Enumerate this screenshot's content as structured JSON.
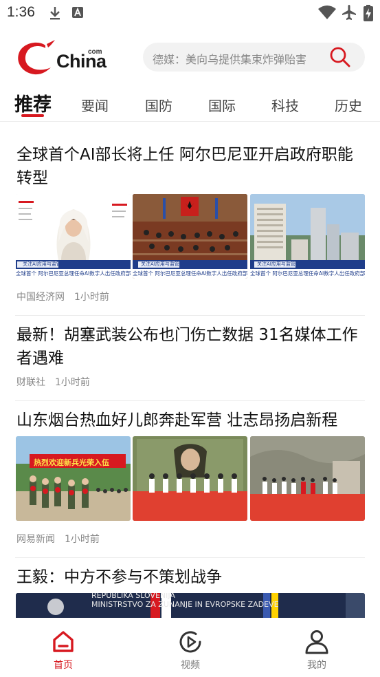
{
  "status_bar": {
    "time": "1:36"
  },
  "header": {
    "logo_text": "China",
    "logo_sup": "com",
    "search_placeholder": "德媒：美向乌提供集束炸弹贻害"
  },
  "tabs": [
    {
      "label": "推荐"
    },
    {
      "label": "要闻"
    },
    {
      "label": "国防"
    },
    {
      "label": "国际"
    },
    {
      "label": "科技"
    },
    {
      "label": "历史"
    }
  ],
  "articles": [
    {
      "title": "全球首个AI部长将上任 阿尔巴尼亚开启政府职能转型",
      "source": "中国经济网",
      "time": "1小时前",
      "caption_tag": "关注AI应用与监管",
      "caption_text": "全球首个 阿尔巴尼亚总理任命AI数字人出任政府部长"
    },
    {
      "title": "最新！胡塞武装公布也门伤亡数据 31名媒体工作者遇难",
      "source": "财联社",
      "time": "1小时前"
    },
    {
      "title": "山东烟台热血好儿郎奔赴军营 壮志昂扬启新程",
      "source": "网易新闻",
      "time": "1小时前",
      "banner_text": "热烈欢迎新兵光荣入伍"
    },
    {
      "title": "王毅：中方不参与不策划战争",
      "sign_line1": "REPUBLIKA SLOVENIJA",
      "sign_line2": "MINISTRSTVO ZA ZUNANJE IN EVROPSKE ZADEVE"
    }
  ],
  "bottom_nav": [
    {
      "label": "首页",
      "icon": "home-icon",
      "active": true
    },
    {
      "label": "视频",
      "icon": "video-play-icon",
      "active": false
    },
    {
      "label": "我的",
      "icon": "user-icon",
      "active": false
    }
  ],
  "colors": {
    "accent": "#d71920",
    "text": "#111111",
    "meta": "#888888"
  }
}
